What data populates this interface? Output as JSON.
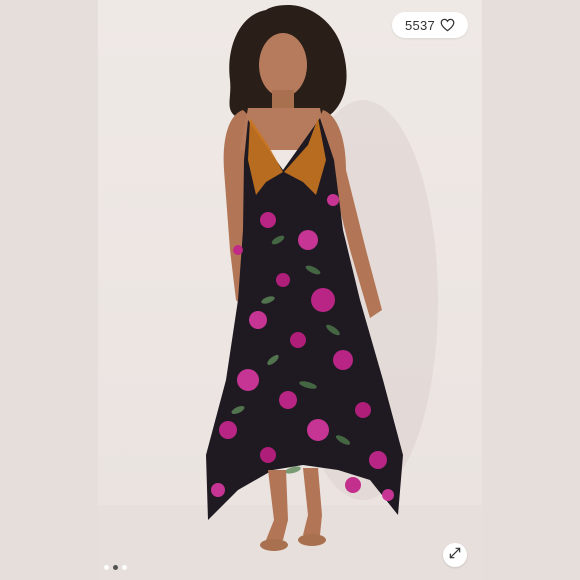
{
  "listing": {
    "like_count": "5537",
    "like_icon": "heart-outline-icon",
    "expand_icon": "expand-arrows-icon"
  },
  "gallery": {
    "total_images": 3,
    "active_index": 1
  },
  "colors": {
    "backdrop": "#e4dcd9",
    "dress_base": "#1f1a22",
    "print_magenta": "#c2268a",
    "print_green": "#4f7a4c",
    "trim_orange": "#c9761f"
  }
}
